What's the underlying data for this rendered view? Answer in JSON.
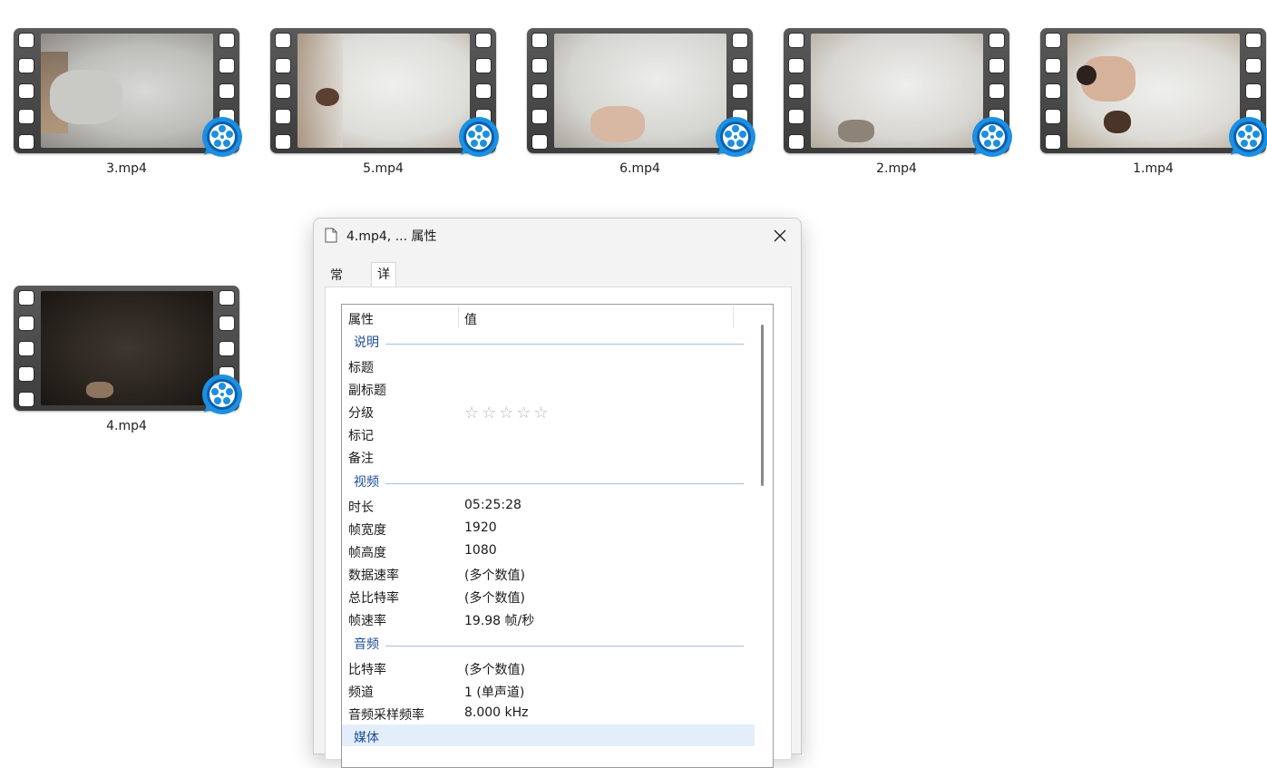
{
  "files": [
    {
      "name": "3.mp4",
      "thumb": "light"
    },
    {
      "name": "5.mp4",
      "thumb": "light"
    },
    {
      "name": "6.mp4",
      "thumb": "light"
    },
    {
      "name": "2.mp4",
      "thumb": "light"
    },
    {
      "name": "1.mp4",
      "thumb": "light"
    },
    {
      "name": "4.mp4",
      "thumb": "dark"
    }
  ],
  "colors": {
    "badge_blue": "#1d8fe1",
    "group_text": "#1f4e9a",
    "group_line": "#a7bfdc"
  },
  "dialog": {
    "title": "4.mp4, ... 属性",
    "tabs": [
      {
        "label": "常规"
      },
      {
        "label": "详细信息"
      }
    ],
    "active_tab": "详细信息",
    "columns": {
      "property": "属性",
      "value": "值"
    },
    "groups": {
      "desc": {
        "label": "说明",
        "rows": [
          {
            "key": "标题",
            "value": ""
          },
          {
            "key": "副标题",
            "value": ""
          },
          {
            "key": "分级",
            "value": "☆☆☆☆☆",
            "rating": 0
          },
          {
            "key": "标记",
            "value": ""
          },
          {
            "key": "备注",
            "value": ""
          }
        ]
      },
      "video": {
        "label": "视频",
        "rows": [
          {
            "key": "时长",
            "value": "05:25:28"
          },
          {
            "key": "帧宽度",
            "value": "1920"
          },
          {
            "key": "帧高度",
            "value": "1080"
          },
          {
            "key": "数据速率",
            "value": "(多个数值)"
          },
          {
            "key": "总比特率",
            "value": "(多个数值)"
          },
          {
            "key": "帧速率",
            "value": "19.98 帧/秒"
          }
        ]
      },
      "audio": {
        "label": "音频",
        "rows": [
          {
            "key": "比特率",
            "value": "(多个数值)"
          },
          {
            "key": "频道",
            "value": "1 (单声道)"
          },
          {
            "key": "音频采样频率",
            "value": "8.000 kHz"
          }
        ]
      },
      "media": {
        "label": "媒体"
      }
    }
  }
}
